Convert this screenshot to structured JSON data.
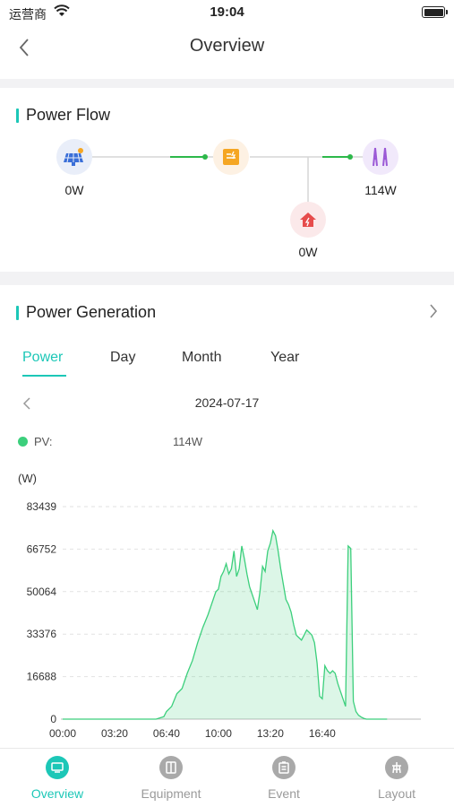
{
  "status_bar": {
    "carrier": "运营商",
    "time": "19:04"
  },
  "header": {
    "title": "Overview"
  },
  "power_flow": {
    "title": "Power Flow",
    "pv_value": "0W",
    "grid_value": "114W",
    "load_value": "0W"
  },
  "power_generation": {
    "title": "Power Generation",
    "tabs": [
      "Power",
      "Day",
      "Month",
      "Year"
    ],
    "active_tab": "Power",
    "date": "2024-07-17",
    "legend": {
      "name": "PV:",
      "value": "114W"
    },
    "unit_label": "(W)"
  },
  "chart_data": {
    "type": "area",
    "ylabel": "(W)",
    "ylim": [
      0,
      83439
    ],
    "yticks": [
      "0",
      "16688",
      "33376",
      "50064",
      "66752",
      "83439"
    ],
    "xticks": [
      "00:00",
      "03:20",
      "06:40",
      "10:00",
      "13:20",
      "16:40"
    ],
    "xlim_minutes": [
      0,
      1380
    ],
    "series": [
      {
        "name": "PV",
        "color": "#3ccf7c",
        "x_minutes": [
          0,
          360,
          390,
          400,
          420,
          440,
          460,
          480,
          500,
          520,
          540,
          560,
          570,
          580,
          590,
          600,
          610,
          620,
          630,
          640,
          650,
          660,
          670,
          680,
          690,
          700,
          710,
          720,
          730,
          740,
          750,
          760,
          770,
          780,
          790,
          800,
          810,
          820,
          830,
          840,
          850,
          860,
          870,
          880,
          890,
          900,
          910,
          920,
          930,
          940,
          950,
          960,
          970,
          980,
          990,
          1000,
          1010,
          1020,
          1030,
          1040,
          1050,
          1060,
          1070,
          1080,
          1090,
          1100,
          1110,
          1120,
          1130,
          1140,
          1150,
          1160,
          1170,
          1175,
          1180,
          1185,
          1190,
          1200,
          1210,
          1230,
          1250
        ],
        "values": [
          0,
          0,
          1000,
          3000,
          5000,
          10000,
          12000,
          18000,
          23000,
          30000,
          36000,
          41000,
          44000,
          47000,
          50000,
          51000,
          56000,
          58000,
          61000,
          57000,
          59000,
          66000,
          56000,
          59000,
          68000,
          63000,
          57000,
          52000,
          49000,
          46000,
          43000,
          50000,
          60000,
          58000,
          66000,
          69000,
          74000,
          72000,
          66000,
          59000,
          53000,
          47000,
          45000,
          42000,
          37000,
          33000,
          32000,
          31000,
          33000,
          35000,
          34000,
          33000,
          30000,
          22000,
          9000,
          8000,
          21000,
          19000,
          18000,
          19000,
          18000,
          14000,
          11000,
          8000,
          5000,
          68000,
          67000,
          7000,
          3000,
          1500,
          800,
          300,
          0,
          0,
          0,
          0,
          0,
          0,
          0,
          0,
          0
        ]
      }
    ]
  },
  "tabbar": {
    "items": [
      {
        "label": "Overview",
        "active": true
      },
      {
        "label": "Equipment",
        "active": false
      },
      {
        "label": "Event",
        "active": false
      },
      {
        "label": "Layout",
        "active": false
      }
    ]
  },
  "colors": {
    "accent": "#1cc7b7",
    "pv_series": "#3ccf7c",
    "flow_line": "#2db84a"
  }
}
